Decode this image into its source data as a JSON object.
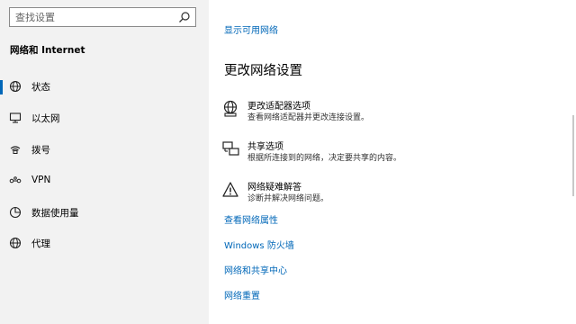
{
  "sidebar": {
    "search_placeholder": "查找设置",
    "section_title": "网络和 Internet",
    "items": [
      {
        "label": "状态",
        "icon": "status-globe-icon",
        "selected": true
      },
      {
        "label": "以太网",
        "icon": "ethernet-icon"
      },
      {
        "label": "拨号",
        "icon": "dialup-icon"
      },
      {
        "label": "VPN",
        "icon": "vpn-icon"
      },
      {
        "label": "数据使用量",
        "icon": "data-usage-icon"
      },
      {
        "label": "代理",
        "icon": "proxy-globe-icon"
      }
    ]
  },
  "main": {
    "show_networks_link": "显示可用网络",
    "heading": "更改网络设置",
    "options": [
      {
        "title": "更改适配器选项",
        "desc": "查看网络适配器并更改连接设置。",
        "icon": "adapter-globe-icon"
      },
      {
        "title": "共享选项",
        "desc": "根据所连接到的网络，决定要共享的内容。",
        "icon": "sharing-icon"
      },
      {
        "title": "网络疑难解答",
        "desc": "诊断并解决网络问题。",
        "icon": "warning-icon"
      }
    ],
    "links": [
      "查看网络属性",
      "Windows 防火墙",
      "网络和共享中心",
      "网络重置"
    ]
  },
  "colors": {
    "accent": "#0067b8",
    "sidebar_bg": "#f2f2f2"
  }
}
